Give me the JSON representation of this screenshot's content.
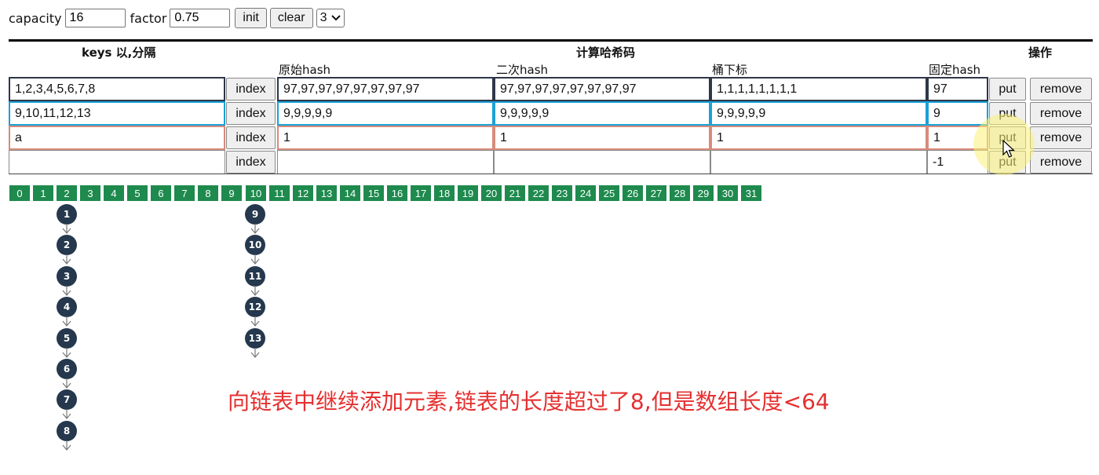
{
  "toolbar": {
    "capacity_label": "capacity",
    "capacity_value": "16",
    "factor_label": "factor",
    "factor_value": "0.75",
    "init_label": "init",
    "clear_label": "clear",
    "select_value": "3",
    "select_icon": "chevron-down-icon"
  },
  "table": {
    "headers": {
      "keys": "keys 以,分隔",
      "compute": "计算哈希码",
      "ops": "操作"
    },
    "subheaders": {
      "orig_hash": "原始hash",
      "second_hash": "二次hash",
      "bucket_index": "桶下标",
      "fixed_hash": "固定hash"
    },
    "index_label": "index",
    "put_label": "put",
    "remove_label": "remove",
    "rows": [
      {
        "keys": "1,2,3,4,5,6,7,8",
        "orig": "97,97,97,97,97,97,97,97",
        "second": "97,97,97,97,97,97,97,97",
        "bucket": "1,1,1,1,1,1,1,1",
        "fixed": "97"
      },
      {
        "keys": "9,10,11,12,13",
        "orig": "9,9,9,9,9",
        "second": "9,9,9,9,9",
        "bucket": "9,9,9,9,9",
        "fixed": "9"
      },
      {
        "keys": "a",
        "orig": "1",
        "second": "1",
        "bucket": "1",
        "fixed": "1"
      },
      {
        "keys": "",
        "orig": "",
        "second": "",
        "bucket": "",
        "fixed": "-1"
      }
    ],
    "row_colors": [
      "#2d3748",
      "#1ba0d7",
      "#d88b7b",
      "#8a8a8a"
    ]
  },
  "buckets": [
    "0",
    "1",
    "2",
    "3",
    "4",
    "5",
    "6",
    "7",
    "8",
    "9",
    "10",
    "11",
    "12",
    "13",
    "14",
    "15",
    "16",
    "17",
    "18",
    "19",
    "20",
    "21",
    "22",
    "23",
    "24",
    "25",
    "26",
    "27",
    "28",
    "29",
    "30",
    "31"
  ],
  "chains": [
    {
      "bucket": "1",
      "nodes": [
        "1",
        "2",
        "3",
        "4",
        "5",
        "6",
        "7",
        "8"
      ]
    },
    {
      "bucket": "9",
      "nodes": [
        "9",
        "10",
        "11",
        "12",
        "13"
      ]
    }
  ],
  "caption": "向链表中继续添加元素,链表的长度超过了8,但是数组长度<64",
  "colors": {
    "bucket_bg": "#1e8a4e",
    "node_bg": "#25384d",
    "caption": "#e53030"
  }
}
